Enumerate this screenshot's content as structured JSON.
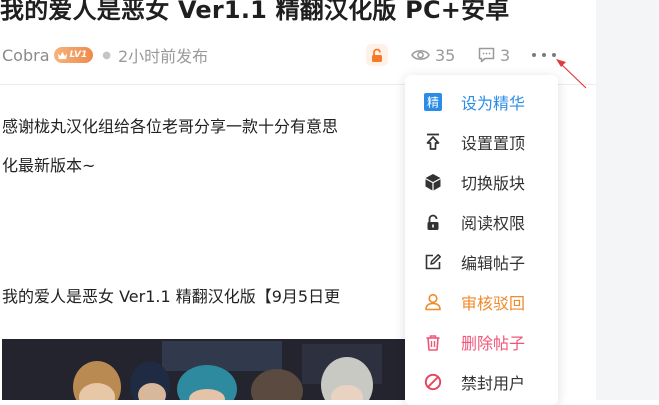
{
  "post": {
    "title": "我的爱人是恶女 Ver1.1 精翻汉化版 PC+安卓",
    "author": "Cobra",
    "level_badge": "LV1",
    "time": "2小时前发布",
    "views": "35",
    "comments": "3"
  },
  "content": {
    "line1": "感谢栊丸汉化组给各位老哥分享一款十分有意思",
    "line2": "化最新版本~",
    "line3": "我的爱人是恶女 Ver1.1 精翻汉化版【9月5日更"
  },
  "menu": {
    "items": [
      {
        "label": "设为精华",
        "icon": "jing-badge-icon",
        "icon_text": "精",
        "color": "#2b8ce8"
      },
      {
        "label": "设置置顶",
        "icon": "pin-top-icon",
        "color": "#333333"
      },
      {
        "label": "切换版块",
        "icon": "cube-icon",
        "color": "#333333"
      },
      {
        "label": "阅读权限",
        "icon": "lock-icon",
        "color": "#333333"
      },
      {
        "label": "编辑帖子",
        "icon": "edit-icon",
        "color": "#333333"
      },
      {
        "label": "审核驳回",
        "icon": "user-reject-icon",
        "color": "#f08a2c"
      },
      {
        "label": "删除帖子",
        "icon": "trash-icon",
        "color": "#f0567a"
      },
      {
        "label": "禁封用户",
        "icon": "ban-icon",
        "color": "#333333"
      }
    ]
  },
  "colors": {
    "accent_blue": "#2b8ce8",
    "reject_orange": "#f08a2c",
    "delete_pink": "#f0567a",
    "lock_orange": "#f47a2a",
    "annotation_red": "#e23b3b"
  }
}
